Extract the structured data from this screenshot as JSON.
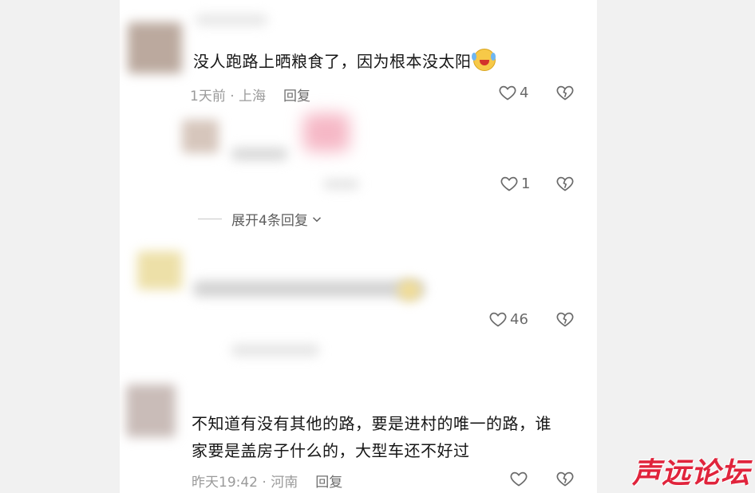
{
  "comments": [
    {
      "text": "没人跑路上晒粮食了，因为根本没太阳",
      "date": "1天前",
      "location": "上海",
      "reply_label": "回复",
      "likes": "4"
    },
    {
      "likes": "1",
      "expand_label": "展开4条回复"
    },
    {
      "likes": "46"
    },
    {
      "text_line1": "不知道有没有其他的路，要是进村的唯一的路，谁",
      "text_line2": "家要是盖房子什么的，大型车还不好过",
      "date": "昨天19:42",
      "location": "河南",
      "reply_label": "回复",
      "likes": ""
    }
  ],
  "watermark": "声远论坛",
  "colors": {
    "watermark": "#e0243c",
    "meta": "#9a9a9a",
    "text": "#161616"
  }
}
